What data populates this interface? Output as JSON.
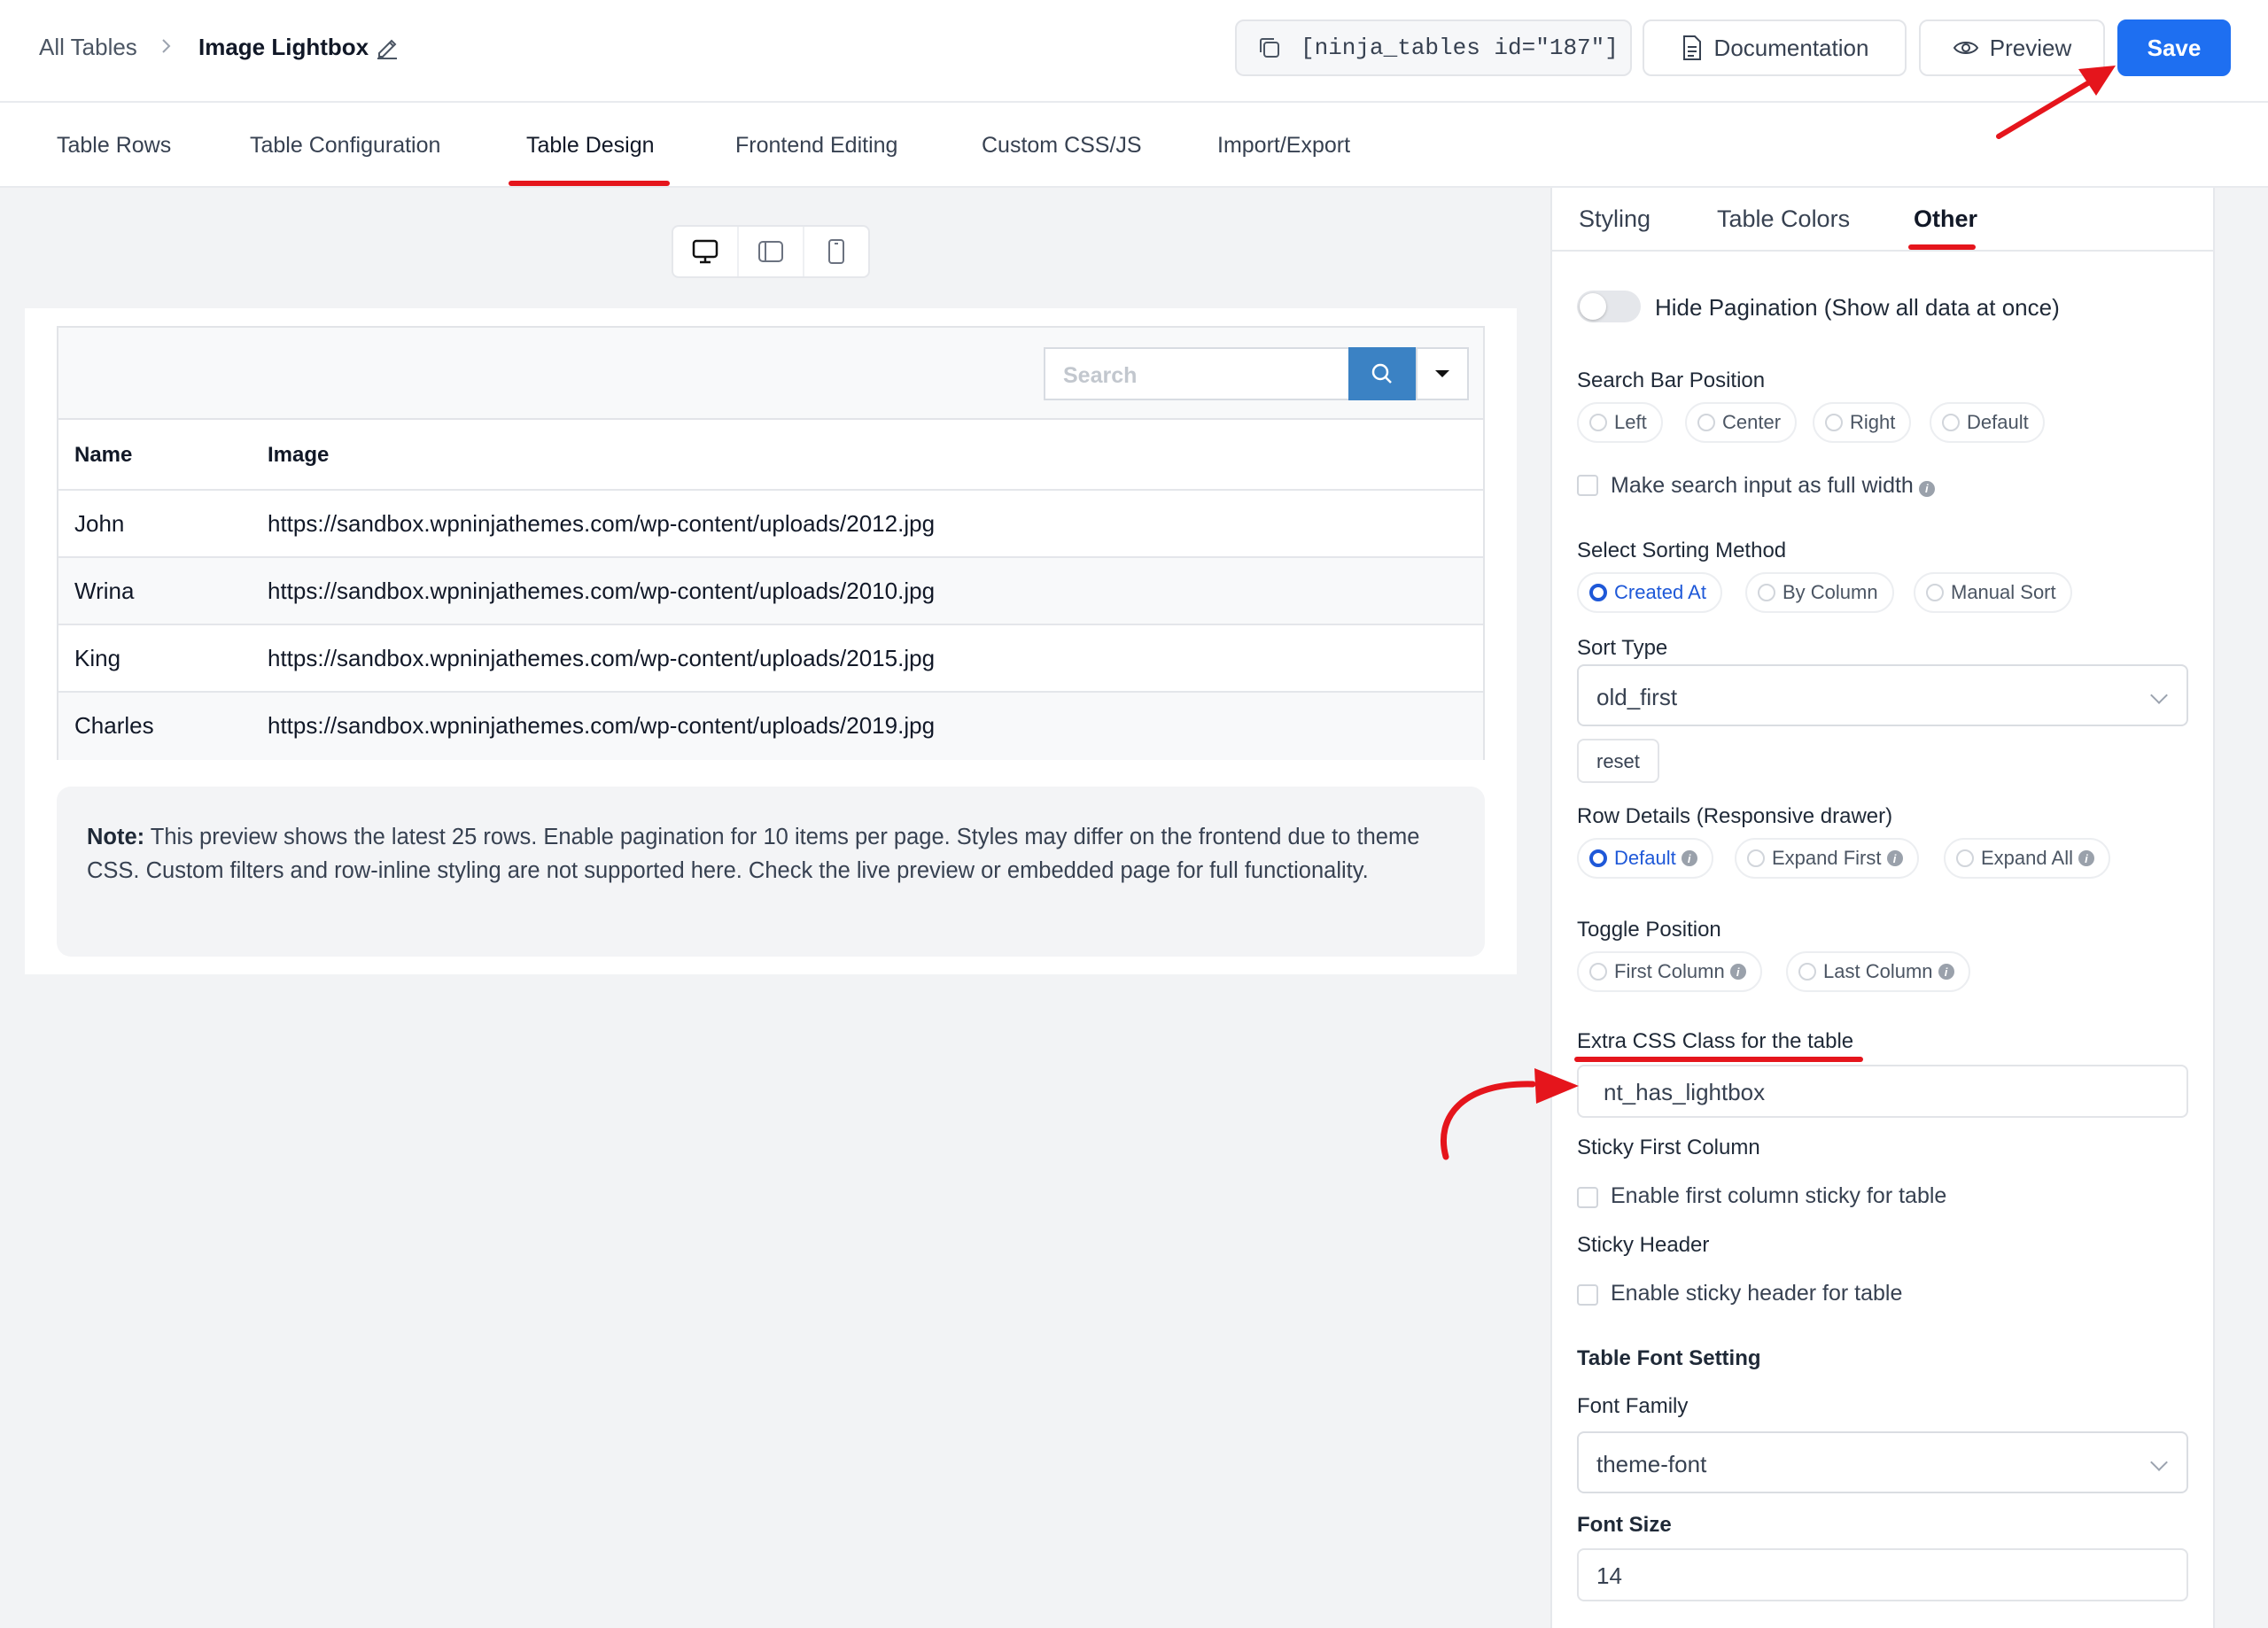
{
  "header": {
    "breadcrumb_root": "All Tables",
    "breadcrumb_sep": ">",
    "table_title": "Image Lightbox",
    "shortcode": "[ninja_tables id=\"187\"]",
    "documentation_label": "Documentation",
    "preview_label": "Preview",
    "save_label": "Save"
  },
  "main_tabs": [
    {
      "label": "Table Rows"
    },
    {
      "label": "Table Configuration"
    },
    {
      "label": "Table Design",
      "active": true
    },
    {
      "label": "Frontend Editing"
    },
    {
      "label": "Custom CSS/JS"
    },
    {
      "label": "Import/Export"
    }
  ],
  "device_toggle": [
    "desktop-icon",
    "tablet-icon",
    "mobile-icon"
  ],
  "preview_table": {
    "search_placeholder": "Search",
    "columns": [
      "Name",
      "Image"
    ],
    "rows": [
      [
        "John",
        "https://sandbox.wpninjathemes.com/wp-content/uploads/2012.jpg"
      ],
      [
        "Wrina",
        "https://sandbox.wpninjathemes.com/wp-content/uploads/2010.jpg"
      ],
      [
        "King",
        "https://sandbox.wpninjathemes.com/wp-content/uploads/2015.jpg"
      ],
      [
        "Charles",
        "https://sandbox.wpninjathemes.com/wp-content/uploads/2019.jpg"
      ]
    ],
    "search_button_color": "#3b82c4"
  },
  "note": {
    "label": "Note:",
    "text": " This preview shows the latest 25 rows. Enable pagination for 10 items per page. Styles may differ on the frontend due to theme CSS. Custom filters and row-inline styling are not supported here. Check the live preview or embedded page for full functionality."
  },
  "settings_panel": {
    "tabs": [
      {
        "label": "Styling"
      },
      {
        "label": "Table Colors"
      },
      {
        "label": "Other",
        "active": true
      }
    ],
    "hide_pagination": {
      "label": "Hide Pagination (Show all data at once)",
      "enabled": false
    },
    "search_bar_position": {
      "label": "Search Bar Position",
      "options": [
        "Left",
        "Center",
        "Right",
        "Default"
      ],
      "selected": null
    },
    "full_width_search": {
      "label": "Make search input as full width",
      "checked": false
    },
    "sorting_method": {
      "label": "Select Sorting Method",
      "options": [
        "Created At",
        "By Column",
        "Manual Sort"
      ],
      "selected": "Created At"
    },
    "sort_type": {
      "label": "Sort Type",
      "value": "old_first",
      "reset_label": "reset"
    },
    "row_details": {
      "label": "Row Details (Responsive drawer)",
      "options": [
        "Default",
        "Expand First",
        "Expand All"
      ],
      "selected": "Default"
    },
    "toggle_position": {
      "label": "Toggle Position",
      "options": [
        "First Column",
        "Last Column"
      ],
      "selected": null
    },
    "extra_css": {
      "label": "Extra CSS Class for the table",
      "value": "nt_has_lightbox"
    },
    "sticky_first_column": {
      "label": "Sticky First Column",
      "checkbox_label": "Enable first column sticky for table",
      "checked": false
    },
    "sticky_header": {
      "label": "Sticky Header",
      "checkbox_label": "Enable sticky header for table",
      "checked": false
    },
    "font_setting": {
      "section_label": "Table Font Setting",
      "family_label": "Font Family",
      "family_value": "theme-font",
      "size_label": "Font Size",
      "size_value": "14"
    }
  },
  "colors": {
    "accent": "#1e6ff1",
    "annotation_red": "#e5151c",
    "selected_radio": "#1e58d8"
  }
}
